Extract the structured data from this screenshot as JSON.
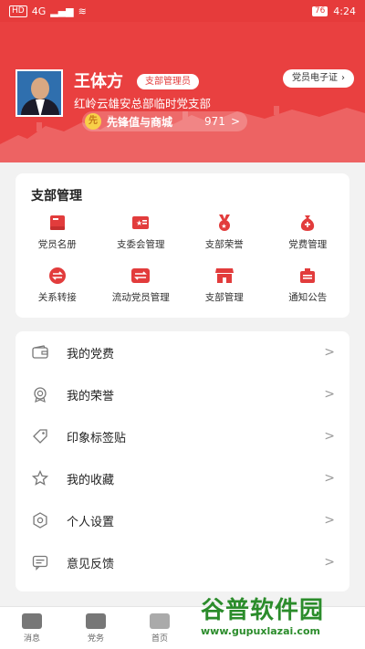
{
  "status_bar": {
    "sim": "HD",
    "network": "4G",
    "battery": "76",
    "time": "4:24"
  },
  "profile": {
    "name": "王体方",
    "role": "支部管理员",
    "org": "红岭云雄安总部临时党支部",
    "shop_label": "先锋值与商城",
    "coin_glyph": "先",
    "points": "971",
    "id_card_label": "党员电子证"
  },
  "branch_mgmt": {
    "title": "支部管理",
    "items": [
      {
        "label": "党员名册",
        "icon": "book-icon"
      },
      {
        "label": "支委会管理",
        "icon": "committee-icon"
      },
      {
        "label": "支部荣誉",
        "icon": "medal-icon"
      },
      {
        "label": "党费管理",
        "icon": "fee-bag-icon"
      },
      {
        "label": "关系转接",
        "icon": "transfer-icon"
      },
      {
        "label": "流动党员管理",
        "icon": "mobile-member-icon"
      },
      {
        "label": "支部管理",
        "icon": "store-icon"
      },
      {
        "label": "通知公告",
        "icon": "notice-icon"
      }
    ]
  },
  "menu": [
    {
      "label": "我的党费",
      "icon": "wallet-icon"
    },
    {
      "label": "我的荣誉",
      "icon": "honor-icon"
    },
    {
      "label": "印象标签贴",
      "icon": "tag-icon"
    },
    {
      "label": "我的收藏",
      "icon": "star-icon"
    },
    {
      "label": "个人设置",
      "icon": "settings-icon"
    },
    {
      "label": "意见反馈",
      "icon": "feedback-icon"
    }
  ],
  "chevron": ">",
  "bottom_nav": [
    {
      "label": "消息",
      "icon": "message-icon"
    },
    {
      "label": "党务",
      "icon": "party-affairs-icon"
    },
    {
      "label": "首页",
      "icon": "home-icon"
    }
  ],
  "watermark": {
    "title": "谷普软件园",
    "url": "www.gupuxlazai.com"
  },
  "colors": {
    "brand_red": "#e94040",
    "icon_red": "#e23c3c"
  }
}
